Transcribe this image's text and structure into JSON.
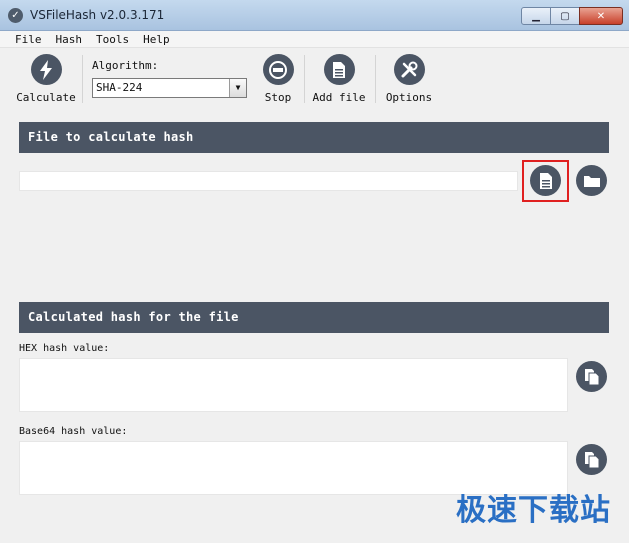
{
  "window": {
    "title": "VSFileHash v2.0.3.171"
  },
  "menu": [
    "File",
    "Hash",
    "Tools",
    "Help"
  ],
  "toolbar": {
    "calculate_label": "Calculate",
    "algorithm_label": "Algorithm:",
    "algorithm_value": "SHA-224",
    "stop_label": "Stop",
    "add_file_label": "Add file",
    "options_label": "Options"
  },
  "file_panel": {
    "title": "File to calculate hash",
    "path_value": ""
  },
  "hash_panel": {
    "title": "Calculated hash for the file",
    "hex_label": "HEX hash value:",
    "hex_value": "",
    "base64_label": "Base64 hash value:",
    "base64_value": ""
  },
  "watermark": "极速下载站",
  "icons": {
    "calculate": "lightning-icon",
    "stop": "stop-icon",
    "add_file": "document-icon",
    "options": "tools-icon",
    "browse_file": "document-icon",
    "browse_folder": "folder-icon",
    "copy": "copy-icon"
  },
  "colors": {
    "accent": "#4b5564",
    "highlight": "#e02020",
    "watermark": "#2a6fc4"
  }
}
